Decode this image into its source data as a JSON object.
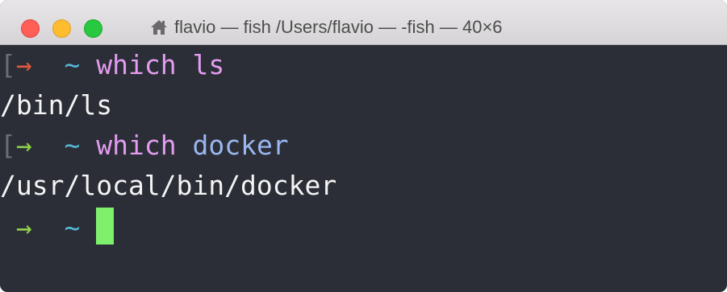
{
  "window": {
    "title": "flavio — fish /Users/flavio — -fish — 40×6",
    "title_icon": "home-icon",
    "controls": [
      "close-button",
      "minimize-button",
      "maximize-button"
    ]
  },
  "terminal": {
    "lines": [
      {
        "bracket": "[",
        "arrow": "→",
        "tilde": "~",
        "command": "which",
        "argument": "ls",
        "status": "error"
      },
      {
        "output": "/bin/ls"
      },
      {
        "bracket": "[",
        "arrow": "→",
        "tilde": "~",
        "command": "which",
        "argument": "docker",
        "status": "success"
      },
      {
        "output": "/usr/local/bin/docker"
      },
      {
        "arrow": "→",
        "tilde": "~",
        "status": "success"
      }
    ]
  },
  "colors": {
    "background": "#2b2e36",
    "error_arrow": "#e0583c",
    "success_arrow": "#8fd24a",
    "tilde": "#56b8d8",
    "command": "#e39cf0",
    "argument_blue": "#9ab7f0",
    "cursor": "#7ef06c"
  }
}
